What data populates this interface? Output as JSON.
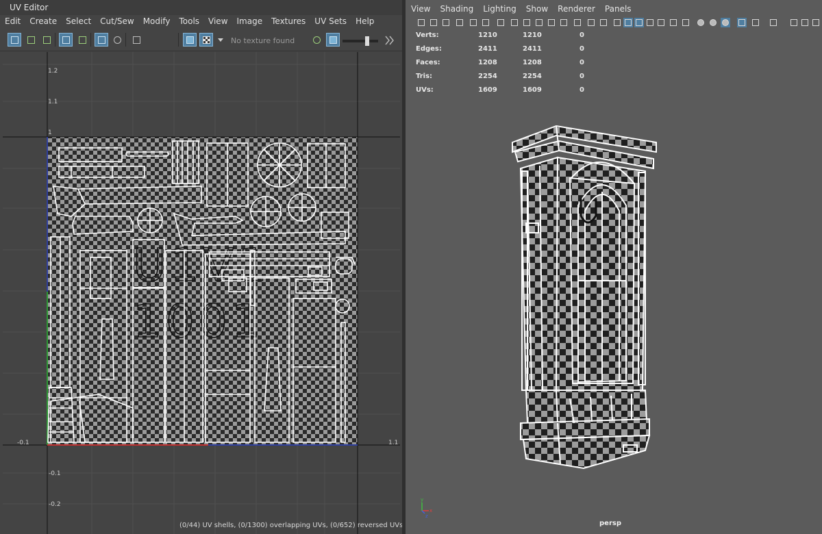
{
  "uv_editor": {
    "title": "UV Editor",
    "menu": [
      "Edit",
      "Create",
      "Select",
      "Cut/Sew",
      "Modify",
      "Tools",
      "View",
      "Image",
      "Textures",
      "UV Sets",
      "Help"
    ],
    "texture_dropdown": "No texture found",
    "axis_labels": {
      "y_1_2": "1.2",
      "y_1_1": "1.1",
      "y_1": "1",
      "y_m01": "-0.1",
      "y_m02": "-0.2",
      "x_m01": "-0.1",
      "x_1_1": "1.1",
      "tile_a": "U1V1",
      "tile_b": "1001"
    },
    "status": "(0/44) UV shells, (0/1300) overlapping UVs, (0/652) reversed UVs"
  },
  "viewport": {
    "menu": [
      "View",
      "Shading",
      "Lighting",
      "Show",
      "Renderer",
      "Panels"
    ],
    "hud": [
      {
        "label": "Verts:",
        "a": "1210",
        "b": "1210",
        "c": "0"
      },
      {
        "label": "Edges:",
        "a": "2411",
        "b": "2411",
        "c": "0"
      },
      {
        "label": "Faces:",
        "a": "1208",
        "b": "1208",
        "c": "0"
      },
      {
        "label": "Tris:",
        "a": "2254",
        "b": "2254",
        "c": "0"
      },
      {
        "label": "UVs:",
        "a": "1609",
        "b": "1609",
        "c": "0"
      }
    ],
    "camera": "persp",
    "axis": {
      "x": "x",
      "y": "y",
      "z": "z"
    }
  }
}
